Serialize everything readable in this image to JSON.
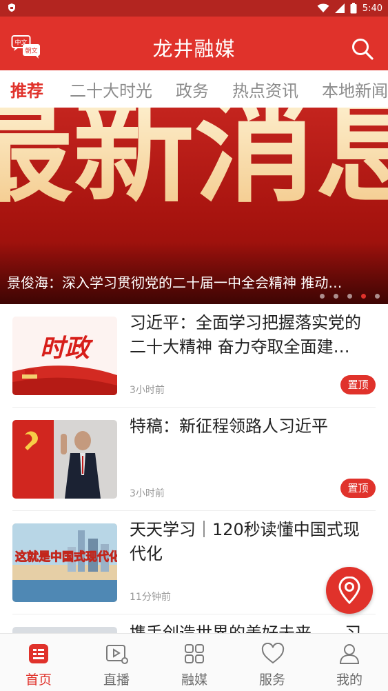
{
  "status_bar": {
    "time": "5:40"
  },
  "header": {
    "title": "龙井融媒",
    "lang_top": "中文",
    "lang_bottom": "朝文"
  },
  "tabs": [
    {
      "label": "推荐",
      "active": true
    },
    {
      "label": "二十大时光",
      "active": false
    },
    {
      "label": "政务",
      "active": false
    },
    {
      "label": "热点资讯",
      "active": false
    },
    {
      "label": "本地新闻",
      "active": false
    }
  ],
  "banner": {
    "art_text": "最新消息",
    "caption": "景俊海：深入学习贯彻党的二十届一中全会精神 推动…",
    "slide_count": 5,
    "active_slide": 4
  },
  "news": [
    {
      "title": "习近平：全面学习把握落实党的二十大精神 奋力夺取全面建…",
      "time": "3小时前",
      "badge": "置顶",
      "thumb_text": "时政"
    },
    {
      "title": "特稿：新征程领路人习近平",
      "time": "3小时前",
      "badge": "置顶",
      "thumb_text": ""
    },
    {
      "title": "天天学习｜120秒读懂中国式现代化",
      "time": "11分钟前",
      "badge": "",
      "thumb_text": "这就是中国式现代化"
    },
    {
      "title": "携手创造世界的美好未来——习",
      "time": "",
      "badge": "",
      "thumb_text": ""
    }
  ],
  "bottom_nav": [
    {
      "label": "首页",
      "icon": "home-news-icon",
      "active": true
    },
    {
      "label": "直播",
      "icon": "live-video-icon",
      "active": false
    },
    {
      "label": "融媒",
      "icon": "grid-media-icon",
      "active": false
    },
    {
      "label": "服务",
      "icon": "heart-service-icon",
      "active": false
    },
    {
      "label": "我的",
      "icon": "profile-icon",
      "active": false
    }
  ],
  "colors": {
    "brand_red": "#e0322b",
    "status_bar": "#b32520",
    "text_dark": "#222222",
    "text_muted": "#999999"
  }
}
